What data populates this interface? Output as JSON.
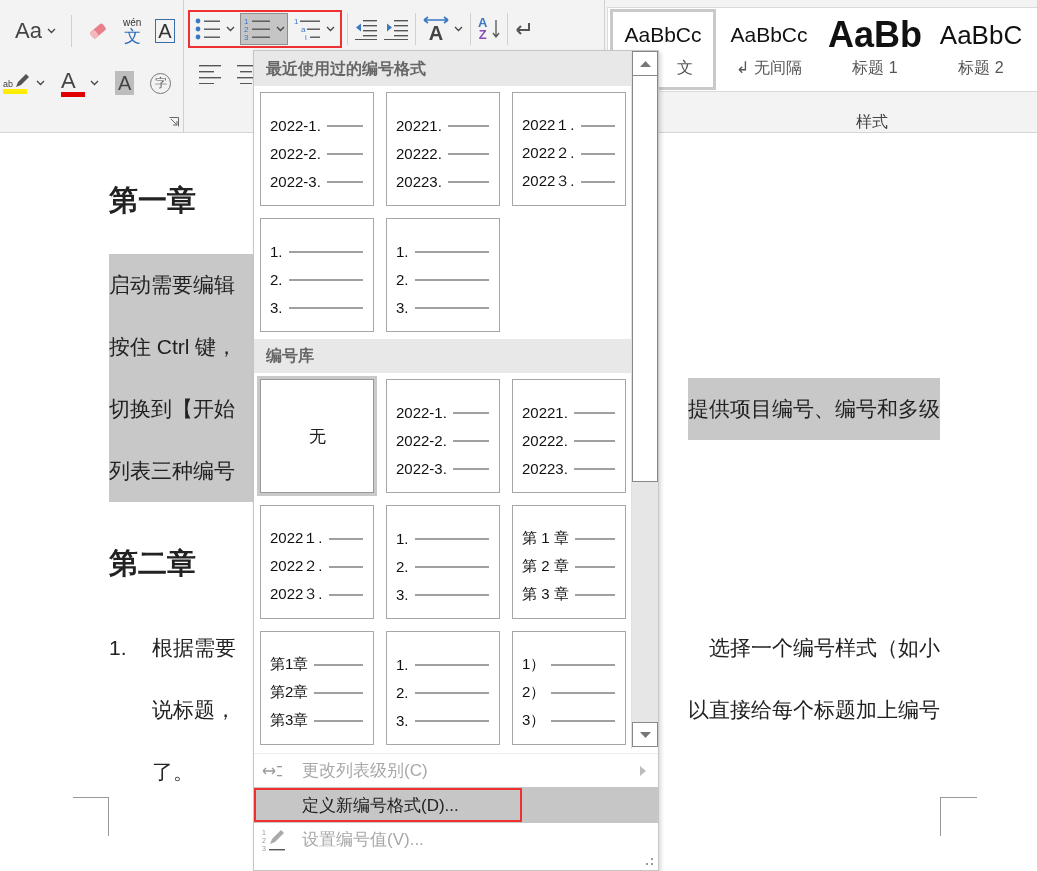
{
  "ribbon": {
    "font_group": {
      "row_1": [
        {
          "kind": "case",
          "label": "Aa"
        },
        {
          "kind": "clear"
        },
        {
          "kind": "phonetic",
          "ruby": "wén",
          "base": "文"
        },
        {
          "kind": "border",
          "label": "A"
        }
      ],
      "row_2": [
        {
          "kind": "highlight",
          "label": "ab"
        },
        {
          "kind": "color",
          "label": "A"
        },
        {
          "kind": "shade",
          "label": "A"
        },
        {
          "kind": "enclose",
          "label": "字"
        }
      ]
    },
    "paragraph_group": {
      "list_buttons": {
        "annotated": true,
        "items": [
          {
            "kind": "bullets",
            "selected": false
          },
          {
            "kind": "numbering",
            "selected": true,
            "marks": [
              "1",
              "2",
              "3"
            ]
          },
          {
            "kind": "multilevel",
            "selected": false,
            "marks": [
              "1",
              "a",
              "i"
            ]
          }
        ]
      },
      "row_1": [
        {
          "kind": "outdent"
        },
        {
          "kind": "indent"
        },
        {
          "kind": "direction",
          "label": "A"
        },
        {
          "kind": "sort",
          "top": "A",
          "bottom": "Z"
        },
        {
          "kind": "marks"
        }
      ],
      "row_2": [
        {
          "kind": "align-left"
        },
        {
          "kind": "align-center"
        }
      ]
    },
    "styles_group": {
      "title": "样式",
      "styles": [
        {
          "kind": "normal",
          "preview": "AaBbCc",
          "label": "文",
          "selected": true
        },
        {
          "kind": "normal",
          "preview": "AaBbCc",
          "label": "↲ 无间隔",
          "selected": false
        },
        {
          "kind": "heading1",
          "preview": "AaBb",
          "label": "标题 1",
          "selected": false
        },
        {
          "kind": "heading2",
          "preview": "AaBbC",
          "label": "标题 2",
          "selected": false
        }
      ]
    }
  },
  "document": {
    "blocks": [
      {
        "kind": "heading",
        "text": "第一章"
      },
      {
        "kind": "paragraph",
        "highlighted": true,
        "lines": [
          {
            "left": "启动需要编辑"
          },
          {
            "left": "按住 Ctrl 键，"
          },
          {
            "left": "切换到【开始",
            "right": "提供项目编号、编号和多级"
          },
          {
            "left": "列表三种编号"
          }
        ]
      },
      {
        "kind": "heading",
        "text": "第二章"
      },
      {
        "kind": "list",
        "number": "1.",
        "lines": [
          {
            "left": "根据需要",
            "right": "选择一个编号样式（如小"
          },
          {
            "left": "说标题，",
            "right": "以直接给每个标题加上编号"
          },
          {
            "left": "了。"
          }
        ]
      }
    ]
  },
  "numbering_menu": {
    "sections": [
      {
        "title": "最近使用过的编号格式",
        "tiles": [
          {
            "kind": "list",
            "selected": false,
            "lines": [
              "2022-1.",
              "2022-2.",
              "2022-3."
            ]
          },
          {
            "kind": "list",
            "selected": false,
            "lines": [
              "20221.",
              "20222.",
              "20223."
            ]
          },
          {
            "kind": "list",
            "selected": false,
            "lines": [
              "2022１.",
              "2022２.",
              "2022３."
            ]
          },
          {
            "kind": "list",
            "selected": false,
            "lines": [
              "1.",
              "2.",
              "3."
            ]
          },
          {
            "kind": "list",
            "selected": false,
            "lines": [
              "1.",
              "2.",
              "3."
            ]
          }
        ]
      },
      {
        "title": "编号库",
        "tiles": [
          {
            "kind": "none",
            "selected": true,
            "label": "无"
          },
          {
            "kind": "list",
            "selected": false,
            "lines": [
              "2022-1.",
              "2022-2.",
              "2022-3."
            ]
          },
          {
            "kind": "list",
            "selected": false,
            "lines": [
              "20221.",
              "20222.",
              "20223."
            ]
          },
          {
            "kind": "list",
            "selected": false,
            "lines": [
              "2022１.",
              "2022２.",
              "2022３."
            ]
          },
          {
            "kind": "list",
            "selected": false,
            "lines": [
              "1.",
              "2.",
              "3."
            ]
          },
          {
            "kind": "list",
            "selected": false,
            "lines": [
              "第 1 章",
              "第 2 章",
              "第 3 章"
            ]
          },
          {
            "kind": "list",
            "selected": false,
            "lines": [
              "第1章",
              "第2章",
              "第3章"
            ]
          },
          {
            "kind": "list",
            "selected": false,
            "lines": [
              "1.",
              "2.",
              "3."
            ]
          },
          {
            "kind": "list",
            "selected": false,
            "lines": [
              "1）",
              "2）",
              "3）"
            ]
          }
        ]
      }
    ],
    "commands": [
      {
        "kind": "level",
        "label": "更改列表级别(C)",
        "disabled": true,
        "highlighted": false,
        "submenu": true
      },
      {
        "kind": "plain",
        "label": "定义新编号格式(D)...",
        "disabled": false,
        "highlighted": true,
        "annotated": true
      },
      {
        "kind": "set-value",
        "label": "设置编号值(V)...",
        "disabled": true,
        "highlighted": false,
        "marks": [
          "1",
          "2",
          "3"
        ]
      }
    ]
  }
}
